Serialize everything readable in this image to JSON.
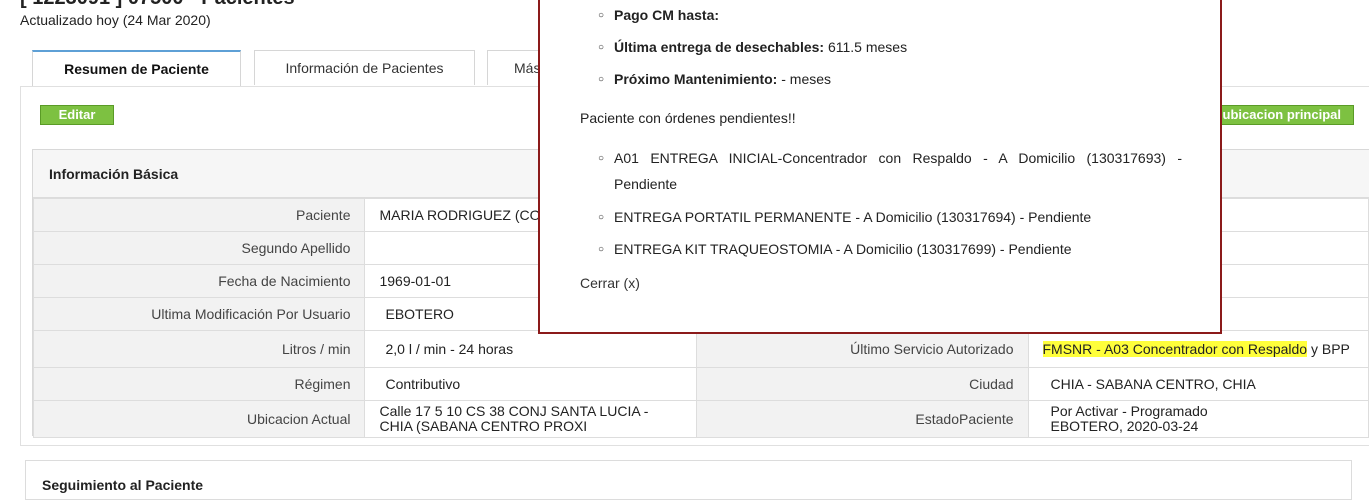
{
  "header": {
    "title": "[ 1223091 ] 07500 - Pacientes",
    "updated": "Actualizado hoy (24 Mar 2020)"
  },
  "tabs": [
    {
      "label": "Resumen de Paciente",
      "active": true
    },
    {
      "label": "Información de Pacientes",
      "active": false
    },
    {
      "label": "Más",
      "active": false
    }
  ],
  "actions": {
    "edit_label": "Editar",
    "ubicacion_label": "ubicacion principal"
  },
  "basic_info": {
    "title": "Información Básica",
    "rows": [
      {
        "label1": "Paciente",
        "value1": "MARIA RODRIGUEZ (CO",
        "label2": "",
        "value2": ""
      },
      {
        "label1": "Segundo Apellido",
        "value1": "",
        "label2": "",
        "value2": ""
      },
      {
        "label1": "Fecha de Nacimiento",
        "value1": "1969-01-01",
        "label2": "",
        "value2": ""
      },
      {
        "label1": "Ultima Modificación Por Usuario",
        "value1": "EBOTERO",
        "label2": "",
        "value2": ""
      },
      {
        "label1": "Litros / min",
        "value1": "2,0 l / min - 24 horas",
        "label2": "Último Servicio Autorizado",
        "value2_highlight": "FMSNR - A03 Concentrador con Respaldo",
        "value2_rest": " y BPP"
      },
      {
        "label1": "Régimen",
        "value1": "Contributivo",
        "label2": "Ciudad",
        "value2": "CHIA - SABANA CENTRO, CHIA"
      },
      {
        "label1": "Ubicacion Actual",
        "value1_line1": "Calle 17 5 10 CS 38 CONJ SANTA LUCIA -",
        "value1_line2": "CHIA (SABANA CENTRO PROXI",
        "label2": "EstadoPaciente",
        "value2_line1": "Por Activar - Programado",
        "value2_line2": "EBOTERO, 2020-03-24"
      }
    ]
  },
  "follow_up": {
    "title": "Seguimiento al Paciente"
  },
  "modal": {
    "items": [
      {
        "label": "Pago CM hasta:",
        "value": ""
      },
      {
        "label": "Última entrega de desechables:",
        "value": " 611.5 meses"
      },
      {
        "label": "Próximo Mantenimiento:",
        "value": " - meses"
      }
    ],
    "pending_title": "Paciente con órdenes pendientes!!",
    "pending": [
      {
        "line1": "A01 ENTREGA INICIAL-Concentrador con Respaldo - A Domicilio (130317693) -",
        "line2": "Pendiente"
      },
      {
        "line1": "ENTREGA PORTATIL PERMANENTE - A Domicilio (130317694) - Pendiente"
      },
      {
        "line1": "ENTREGA KIT TRAQUEOSTOMIA - A Domicilio (130317699) - Pendiente"
      }
    ],
    "close_label": "Cerrar (x)"
  },
  "colors": {
    "accent_green": "#7dc141",
    "modal_border": "#8b1a1a",
    "highlight": "#ffff3b",
    "tab_active": "#5ea0d6"
  }
}
